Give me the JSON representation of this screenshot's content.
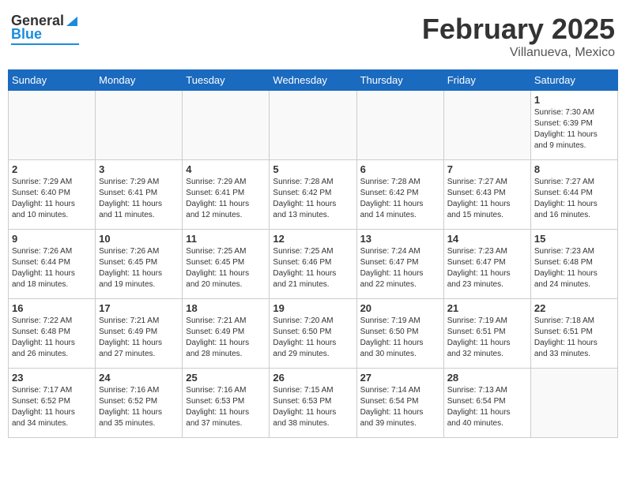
{
  "header": {
    "logo_general": "General",
    "logo_blue": "Blue",
    "title": "February 2025",
    "location": "Villanueva, Mexico"
  },
  "weekdays": [
    "Sunday",
    "Monday",
    "Tuesday",
    "Wednesday",
    "Thursday",
    "Friday",
    "Saturday"
  ],
  "weeks": [
    [
      {
        "day": "",
        "info": ""
      },
      {
        "day": "",
        "info": ""
      },
      {
        "day": "",
        "info": ""
      },
      {
        "day": "",
        "info": ""
      },
      {
        "day": "",
        "info": ""
      },
      {
        "day": "",
        "info": ""
      },
      {
        "day": "1",
        "info": "Sunrise: 7:30 AM\nSunset: 6:39 PM\nDaylight: 11 hours\nand 9 minutes."
      }
    ],
    [
      {
        "day": "2",
        "info": "Sunrise: 7:29 AM\nSunset: 6:40 PM\nDaylight: 11 hours\nand 10 minutes."
      },
      {
        "day": "3",
        "info": "Sunrise: 7:29 AM\nSunset: 6:41 PM\nDaylight: 11 hours\nand 11 minutes."
      },
      {
        "day": "4",
        "info": "Sunrise: 7:29 AM\nSunset: 6:41 PM\nDaylight: 11 hours\nand 12 minutes."
      },
      {
        "day": "5",
        "info": "Sunrise: 7:28 AM\nSunset: 6:42 PM\nDaylight: 11 hours\nand 13 minutes."
      },
      {
        "day": "6",
        "info": "Sunrise: 7:28 AM\nSunset: 6:42 PM\nDaylight: 11 hours\nand 14 minutes."
      },
      {
        "day": "7",
        "info": "Sunrise: 7:27 AM\nSunset: 6:43 PM\nDaylight: 11 hours\nand 15 minutes."
      },
      {
        "day": "8",
        "info": "Sunrise: 7:27 AM\nSunset: 6:44 PM\nDaylight: 11 hours\nand 16 minutes."
      }
    ],
    [
      {
        "day": "9",
        "info": "Sunrise: 7:26 AM\nSunset: 6:44 PM\nDaylight: 11 hours\nand 18 minutes."
      },
      {
        "day": "10",
        "info": "Sunrise: 7:26 AM\nSunset: 6:45 PM\nDaylight: 11 hours\nand 19 minutes."
      },
      {
        "day": "11",
        "info": "Sunrise: 7:25 AM\nSunset: 6:45 PM\nDaylight: 11 hours\nand 20 minutes."
      },
      {
        "day": "12",
        "info": "Sunrise: 7:25 AM\nSunset: 6:46 PM\nDaylight: 11 hours\nand 21 minutes."
      },
      {
        "day": "13",
        "info": "Sunrise: 7:24 AM\nSunset: 6:47 PM\nDaylight: 11 hours\nand 22 minutes."
      },
      {
        "day": "14",
        "info": "Sunrise: 7:23 AM\nSunset: 6:47 PM\nDaylight: 11 hours\nand 23 minutes."
      },
      {
        "day": "15",
        "info": "Sunrise: 7:23 AM\nSunset: 6:48 PM\nDaylight: 11 hours\nand 24 minutes."
      }
    ],
    [
      {
        "day": "16",
        "info": "Sunrise: 7:22 AM\nSunset: 6:48 PM\nDaylight: 11 hours\nand 26 minutes."
      },
      {
        "day": "17",
        "info": "Sunrise: 7:21 AM\nSunset: 6:49 PM\nDaylight: 11 hours\nand 27 minutes."
      },
      {
        "day": "18",
        "info": "Sunrise: 7:21 AM\nSunset: 6:49 PM\nDaylight: 11 hours\nand 28 minutes."
      },
      {
        "day": "19",
        "info": "Sunrise: 7:20 AM\nSunset: 6:50 PM\nDaylight: 11 hours\nand 29 minutes."
      },
      {
        "day": "20",
        "info": "Sunrise: 7:19 AM\nSunset: 6:50 PM\nDaylight: 11 hours\nand 30 minutes."
      },
      {
        "day": "21",
        "info": "Sunrise: 7:19 AM\nSunset: 6:51 PM\nDaylight: 11 hours\nand 32 minutes."
      },
      {
        "day": "22",
        "info": "Sunrise: 7:18 AM\nSunset: 6:51 PM\nDaylight: 11 hours\nand 33 minutes."
      }
    ],
    [
      {
        "day": "23",
        "info": "Sunrise: 7:17 AM\nSunset: 6:52 PM\nDaylight: 11 hours\nand 34 minutes."
      },
      {
        "day": "24",
        "info": "Sunrise: 7:16 AM\nSunset: 6:52 PM\nDaylight: 11 hours\nand 35 minutes."
      },
      {
        "day": "25",
        "info": "Sunrise: 7:16 AM\nSunset: 6:53 PM\nDaylight: 11 hours\nand 37 minutes."
      },
      {
        "day": "26",
        "info": "Sunrise: 7:15 AM\nSunset: 6:53 PM\nDaylight: 11 hours\nand 38 minutes."
      },
      {
        "day": "27",
        "info": "Sunrise: 7:14 AM\nSunset: 6:54 PM\nDaylight: 11 hours\nand 39 minutes."
      },
      {
        "day": "28",
        "info": "Sunrise: 7:13 AM\nSunset: 6:54 PM\nDaylight: 11 hours\nand 40 minutes."
      },
      {
        "day": "",
        "info": ""
      }
    ]
  ]
}
